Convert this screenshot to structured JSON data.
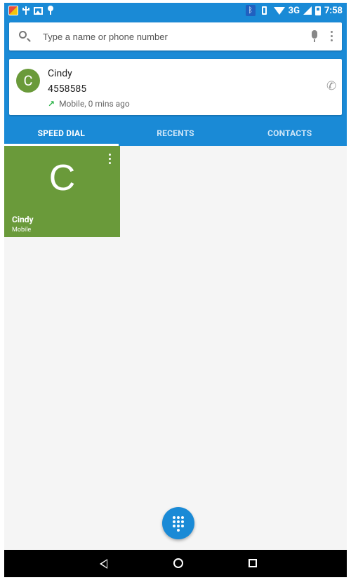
{
  "status_bar": {
    "network": "3G",
    "time": "7:58",
    "left_icons": [
      "app-icon",
      "usb-icon",
      "image-icon",
      "pin-icon"
    ],
    "right_icons": [
      "bluetooth-icon",
      "vibrate-icon",
      "wifi-icon",
      "signal-icon",
      "battery-icon"
    ]
  },
  "search": {
    "placeholder": "Type a name or phone number"
  },
  "recent_call": {
    "avatar_letter": "C",
    "name": "Cindy",
    "number": "4558585",
    "info": "Mobile, 0 mins ago",
    "direction_icon": "↗"
  },
  "tabs": [
    {
      "label": "SPEED DIAL"
    },
    {
      "label": "RECENTS"
    },
    {
      "label": "CONTACTS"
    }
  ],
  "speed_dial": {
    "letter": "C",
    "name": "Cindy",
    "type": "Mobile"
  },
  "colors": {
    "primary": "#1a8ad6",
    "contact_green": "#6a9a3a",
    "outgoing_arrow": "#2eb44a"
  }
}
